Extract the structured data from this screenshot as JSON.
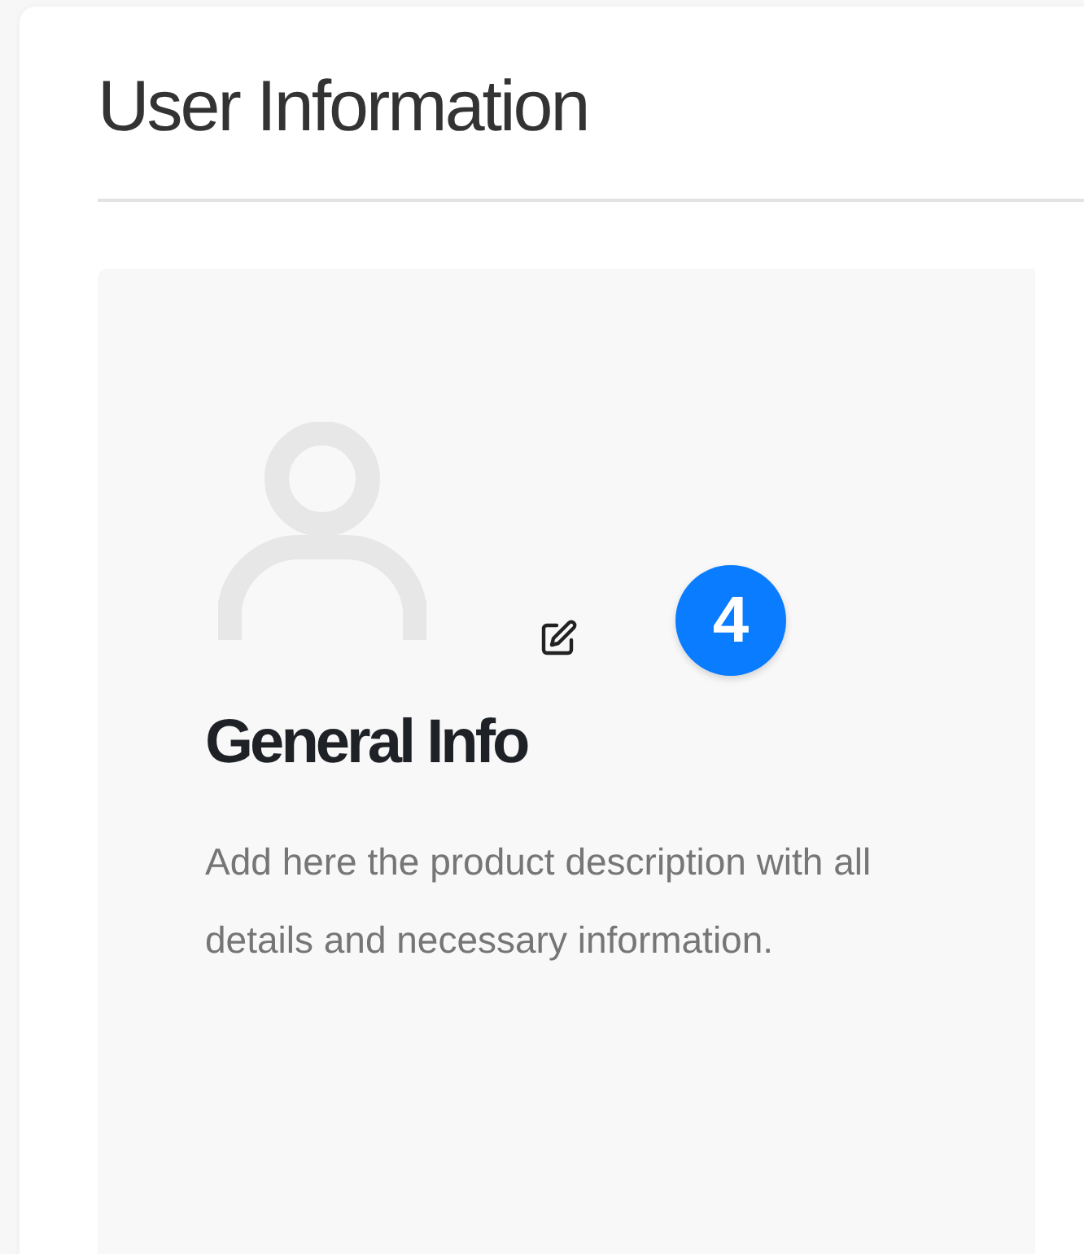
{
  "page_title": "User Information",
  "card": {
    "badge": "4",
    "heading": "General Info",
    "description": "Add here the product description with all details and necessary information."
  }
}
